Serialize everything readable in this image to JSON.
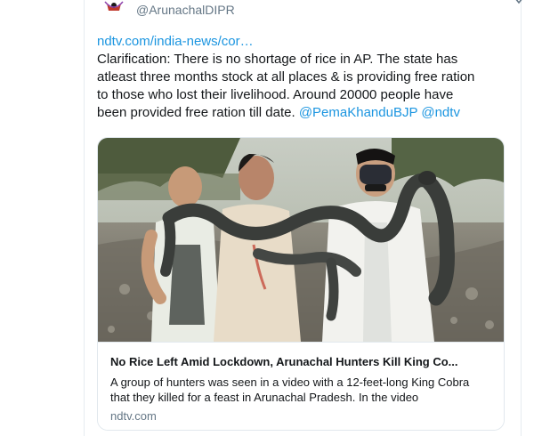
{
  "tweet": {
    "author_handle": "@ArunachalDIPR",
    "text": {
      "link": "ndtv.com/india-news/cor…",
      "line1": "Clarification: There is no shortage of rice in AP. The state has",
      "line2": "atleast three months stock at all places & is providing free ration",
      "line3": "to those who lost their livelihood. Around 20000 people have",
      "line4_plain": "been provided free ration till date. ",
      "mention1": "@PemaKhanduBJP",
      "mention2": "@ndtv"
    }
  },
  "link_card": {
    "title": "No Rice Left Amid Lockdown, Arunachal Hunters Kill King Co...",
    "description": "A group of hunters was seen in a video with a 12-feet-long King Cobra that they killed for a feast in Arunachal Pradesh. In the video",
    "domain": "ndtv.com",
    "image_description_icon": "photo-hunters-with-king-cobra"
  },
  "colors": {
    "link": "#1b95e0",
    "text": "#14171a",
    "muted": "#657786",
    "border": "#e1e8ed"
  }
}
